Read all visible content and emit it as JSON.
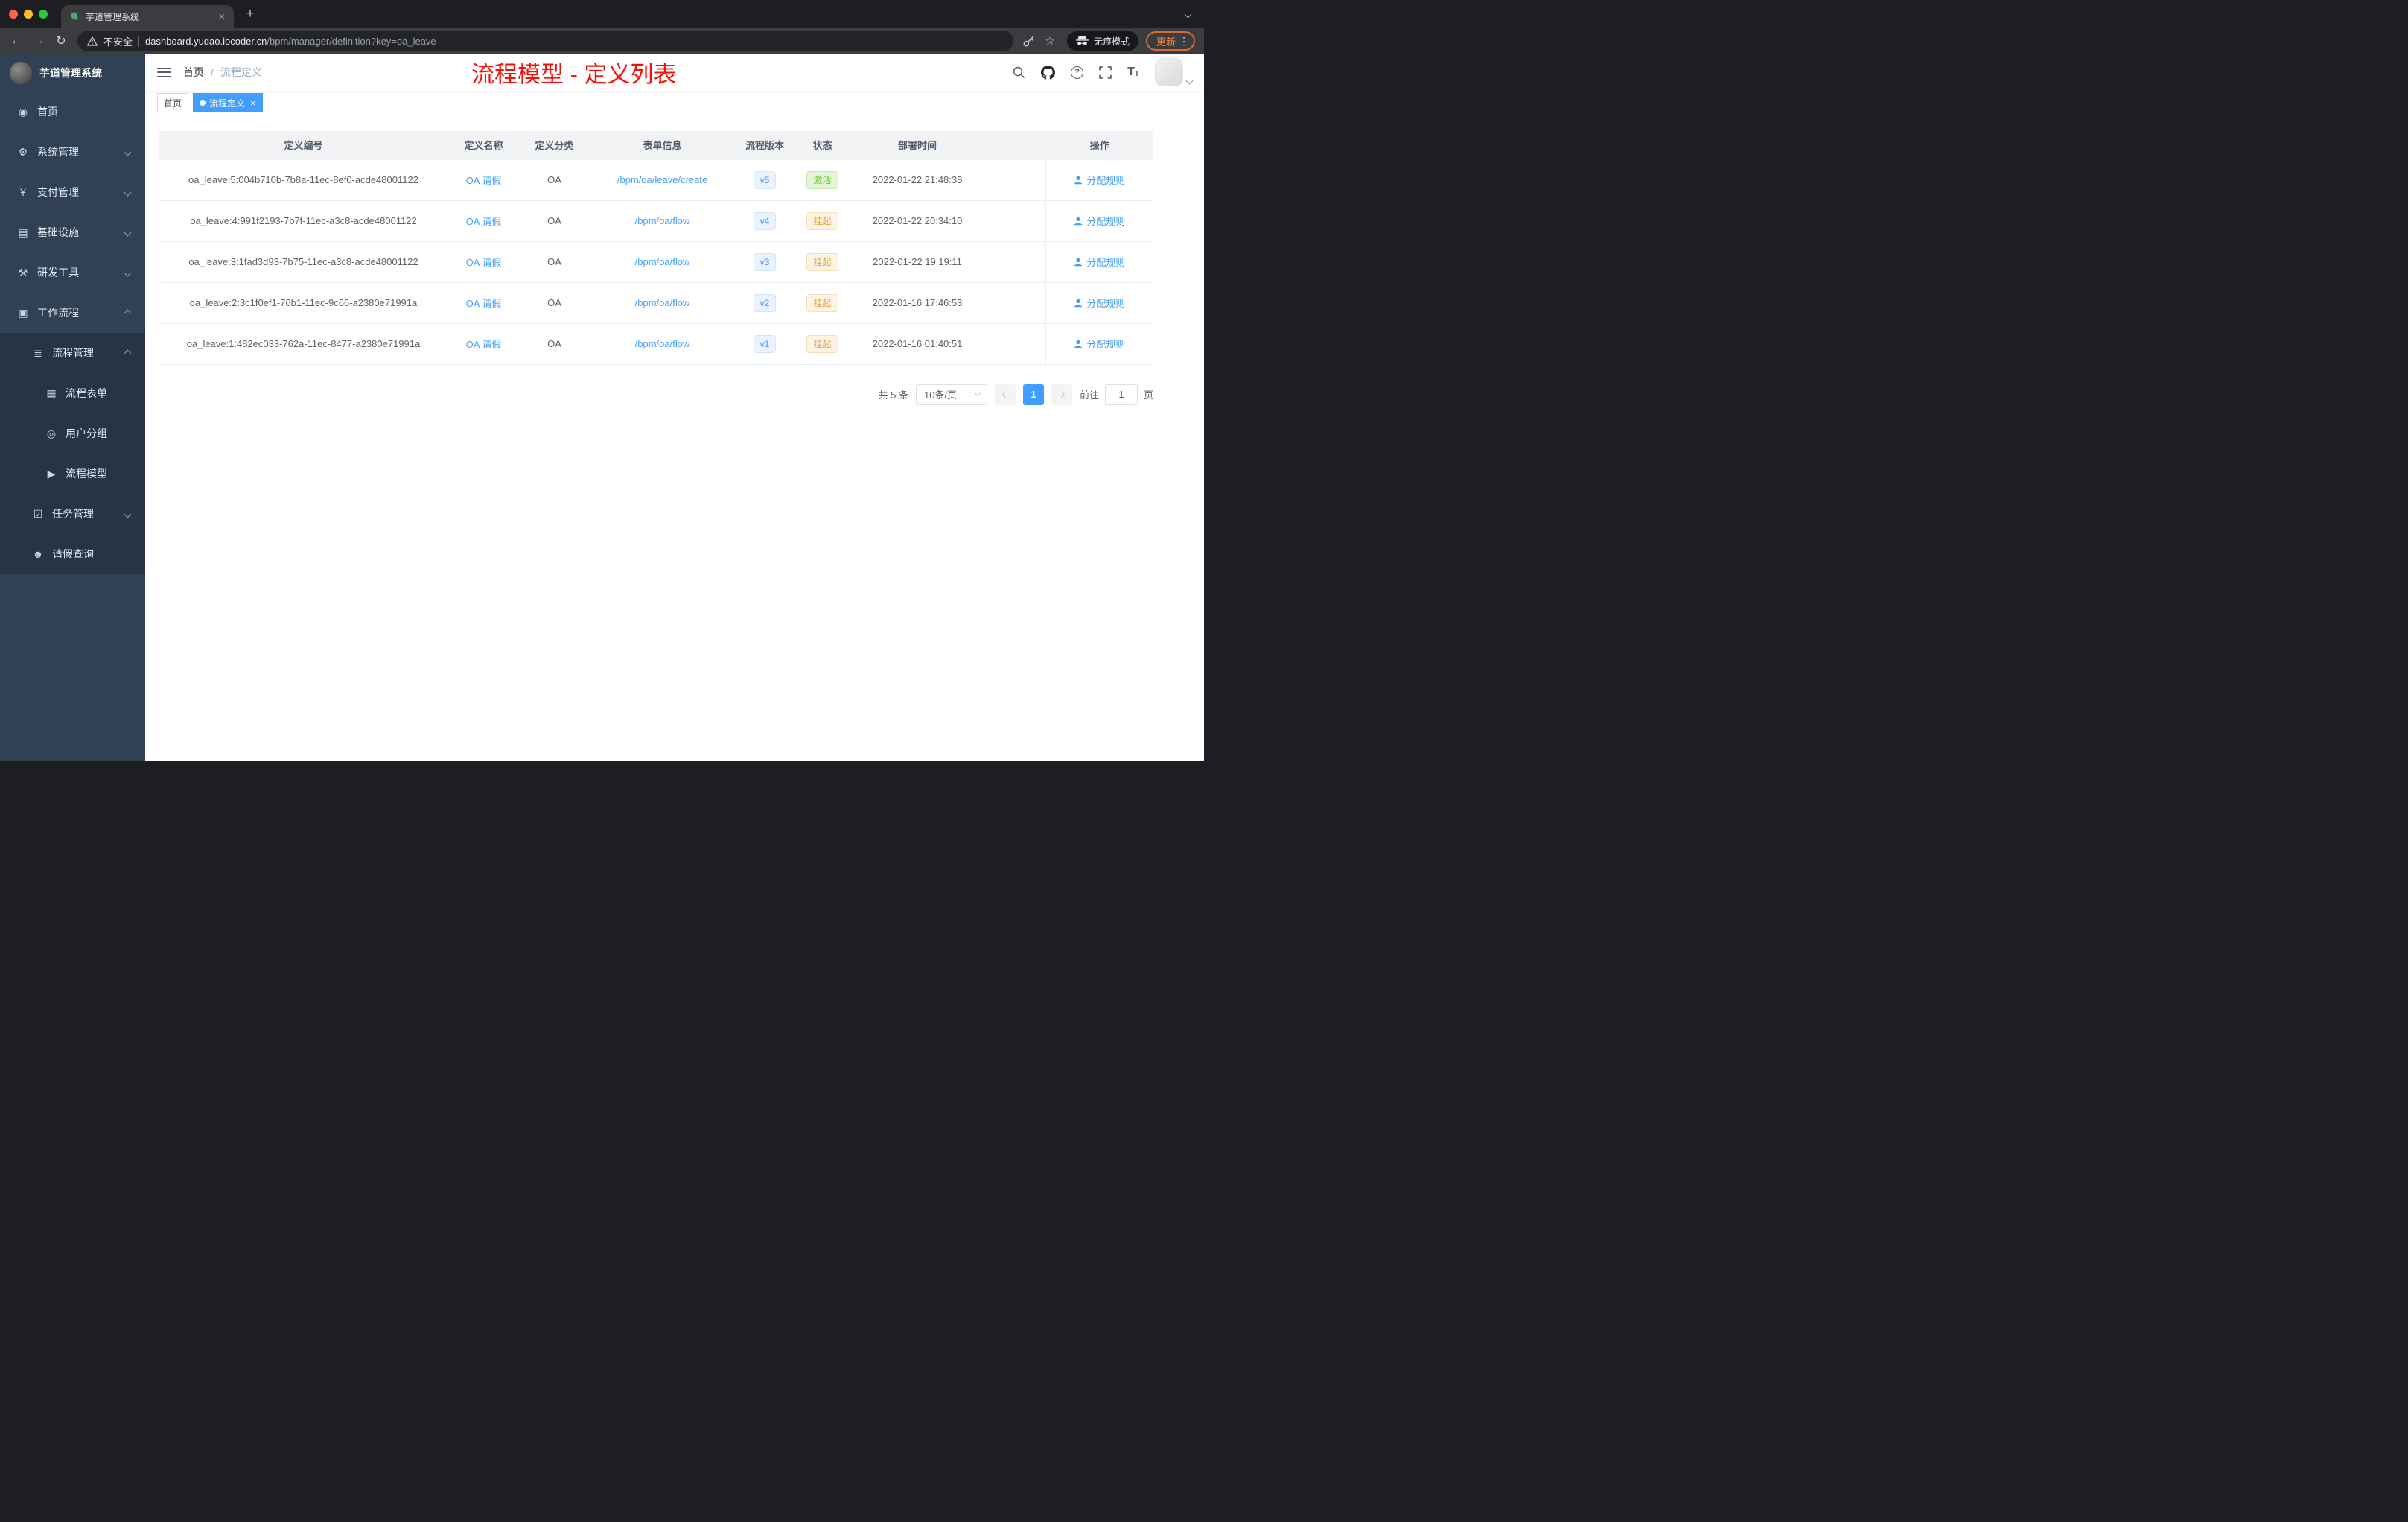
{
  "colors": {
    "accent_blue": "#409eff",
    "success_green": "#67c23a",
    "warning_yellow": "#e6a23c",
    "annotation_red": "#f4100b",
    "update_orange": "#f0883e",
    "sidebar_bg": "#304156",
    "sidebar_submenu_bg": "#263445"
  },
  "icons": {
    "close": "×",
    "plus": "+",
    "back": "←",
    "forward": "→",
    "reload": "↻",
    "star": "☆",
    "kebab": "⋮",
    "question": "?"
  },
  "browser": {
    "tab_title": "芋道管理系统",
    "security_label": "不安全",
    "url_domain": "dashboard.yudao.iocoder.cn",
    "url_path": "/bpm/manager/definition?key=oa_leave",
    "incognito_label": "无痕模式",
    "update_label": "更新"
  },
  "sidebar": {
    "logo_title": "芋道管理系统",
    "items": [
      {
        "key": "home",
        "label": "首页",
        "icon": "dashboard-icon",
        "glyph": "◉",
        "level": 0,
        "arrow": null,
        "dark": false
      },
      {
        "key": "system-manage",
        "label": "系统管理",
        "icon": "gear-icon",
        "glyph": "⚙",
        "level": 0,
        "arrow": "down",
        "dark": false
      },
      {
        "key": "payment-manage",
        "label": "支付管理",
        "icon": "yen-icon",
        "glyph": "¥",
        "level": 0,
        "arrow": "down",
        "dark": false
      },
      {
        "key": "infrastructure",
        "label": "基础设施",
        "icon": "infrastructure-icon",
        "glyph": "▤",
        "level": 0,
        "arrow": "down",
        "dark": false
      },
      {
        "key": "dev-tools",
        "label": "研发工具",
        "icon": "tools-icon",
        "glyph": "⚒",
        "level": 0,
        "arrow": "down",
        "dark": false
      },
      {
        "key": "workflow",
        "label": "工作流程",
        "icon": "workflow-icon",
        "glyph": "▣",
        "level": 0,
        "arrow": "up",
        "dark": false
      },
      {
        "key": "process-manage",
        "label": "流程管理",
        "icon": "process-list-icon",
        "glyph": "≣",
        "level": 1,
        "arrow": "up",
        "dark": true
      },
      {
        "key": "process-form",
        "label": "流程表单",
        "icon": "form-icon",
        "glyph": "▦",
        "level": 2,
        "arrow": null,
        "dark": true
      },
      {
        "key": "user-group",
        "label": "用户分组",
        "icon": "user-group-icon",
        "glyph": "◎",
        "level": 2,
        "arrow": null,
        "dark": true
      },
      {
        "key": "process-model",
        "label": "流程模型",
        "icon": "paper-plane-icon",
        "glyph": "▶",
        "level": 2,
        "arrow": null,
        "dark": true
      },
      {
        "key": "task-manage",
        "label": "任务管理",
        "icon": "task-icon",
        "glyph": "☑",
        "level": 1,
        "arrow": "down",
        "dark": true
      },
      {
        "key": "leave-query",
        "label": "请假查询",
        "icon": "person-icon",
        "glyph": "☻",
        "level": 1,
        "arrow": null,
        "dark": true
      }
    ]
  },
  "header": {
    "breadcrumb": [
      "首页",
      "流程定义"
    ],
    "separator": "/",
    "annotation": "流程模型 - 定义列表"
  },
  "tags": [
    {
      "label": "首页",
      "active": false,
      "closable": false
    },
    {
      "label": "流程定义",
      "active": true,
      "closable": true
    }
  ],
  "table": {
    "columns": [
      "定义编号",
      "定义名称",
      "定义分类",
      "表单信息",
      "流程版本",
      "状态",
      "部署时间",
      "操作"
    ],
    "rows": [
      {
        "id": "oa_leave:5:004b710b-7b8a-11ec-8ef0-acde48001122",
        "name": "OA 请假",
        "category": "OA",
        "form": "/bpm/oa/leave/create",
        "version": "v5",
        "status": "激活",
        "status_type": "success",
        "deploy_time": "2022-01-22 21:48:38",
        "action": "分配规则"
      },
      {
        "id": "oa_leave:4:991f2193-7b7f-11ec-a3c8-acde48001122",
        "name": "OA 请假",
        "category": "OA",
        "form": "/bpm/oa/flow",
        "version": "v4",
        "status": "挂起",
        "status_type": "warning",
        "deploy_time": "2022-01-22 20:34:10",
        "action": "分配规则"
      },
      {
        "id": "oa_leave:3:1fad3d93-7b75-11ec-a3c8-acde48001122",
        "name": "OA 请假",
        "category": "OA",
        "form": "/bpm/oa/flow",
        "version": "v3",
        "status": "挂起",
        "status_type": "warning",
        "deploy_time": "2022-01-22 19:19:11",
        "action": "分配规则"
      },
      {
        "id": "oa_leave:2:3c1f0ef1-76b1-11ec-9c66-a2380e71991a",
        "name": "OA 请假",
        "category": "OA",
        "form": "/bpm/oa/flow",
        "version": "v2",
        "status": "挂起",
        "status_type": "warning",
        "deploy_time": "2022-01-16 17:46:53",
        "action": "分配规则"
      },
      {
        "id": "oa_leave:1:482ec033-762a-11ec-8477-a2380e71991a",
        "name": "OA 请假",
        "category": "OA",
        "form": "/bpm/oa/flow",
        "version": "v1",
        "status": "挂起",
        "status_type": "warning",
        "deploy_time": "2022-01-16 01:40:51",
        "action": "分配规则"
      }
    ]
  },
  "pagination": {
    "total": "共 5 条",
    "page_size": "10条/页",
    "current_page": "1",
    "goto_label": "前往",
    "goto_value": "1",
    "goto_unit": "页"
  }
}
